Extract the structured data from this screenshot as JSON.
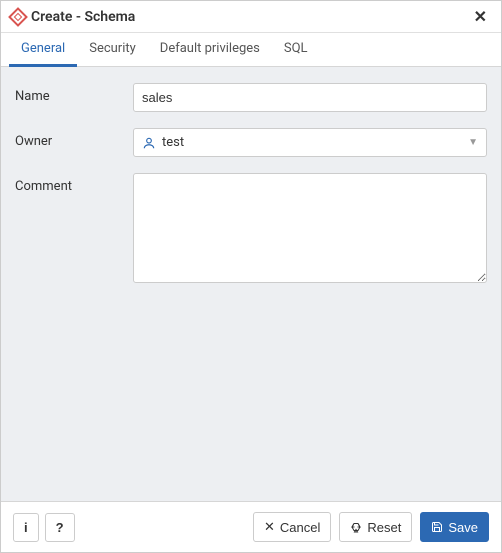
{
  "header": {
    "title": "Create - Schema"
  },
  "tabs": [
    {
      "label": "General",
      "active": true
    },
    {
      "label": "Security",
      "active": false
    },
    {
      "label": "Default privileges",
      "active": false
    },
    {
      "label": "SQL",
      "active": false
    }
  ],
  "form": {
    "name_label": "Name",
    "name_value": "sales",
    "owner_label": "Owner",
    "owner_value": "test",
    "comment_label": "Comment",
    "comment_value": ""
  },
  "footer": {
    "cancel_label": "Cancel",
    "reset_label": "Reset",
    "save_label": "Save"
  }
}
